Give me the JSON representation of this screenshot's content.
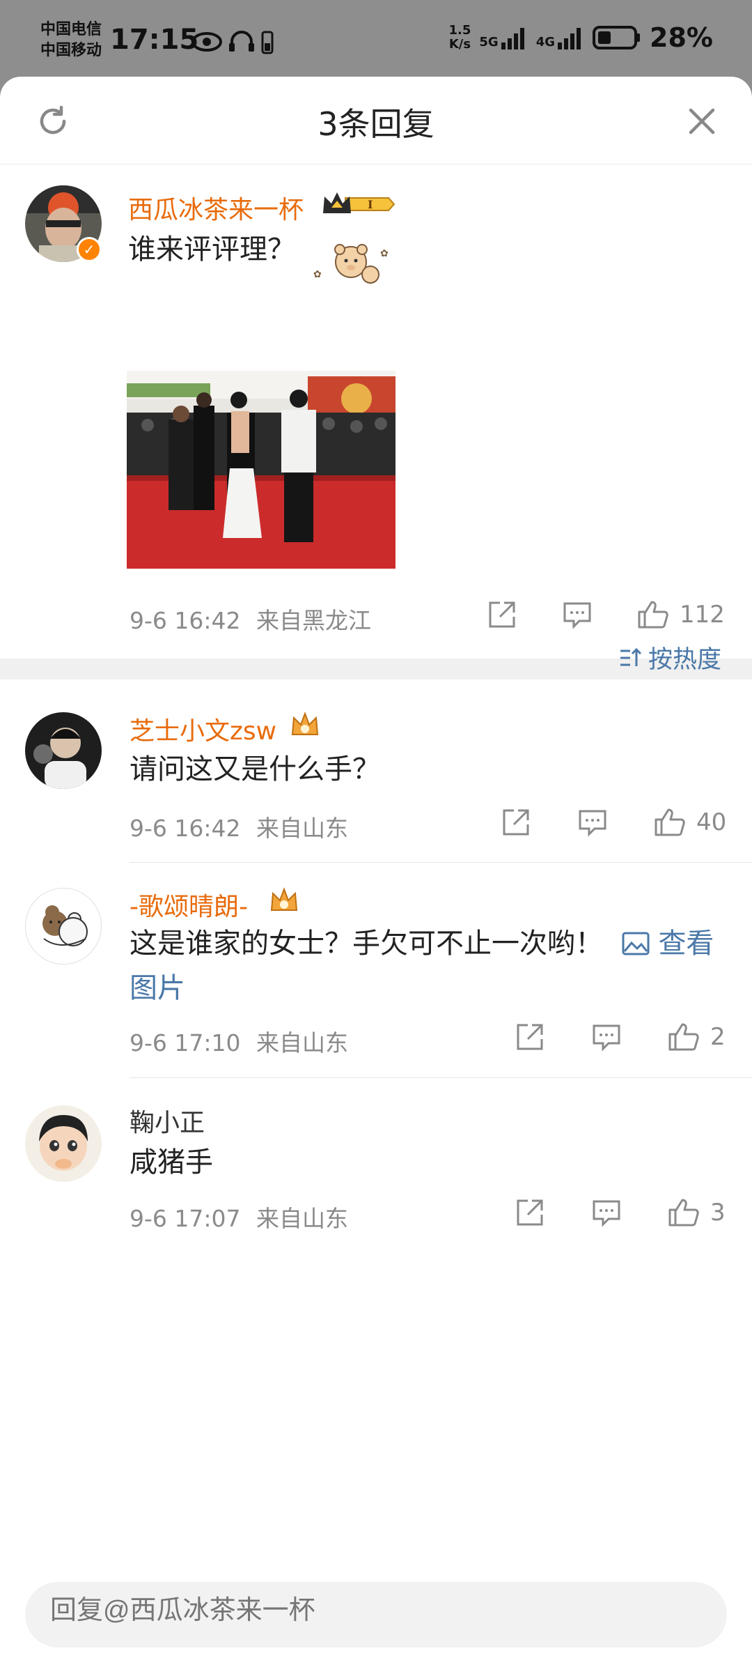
{
  "status_bar": {
    "carrier1": "中国电信",
    "carrier2": "中国移动",
    "time": "17:15",
    "speed_top": "1.5",
    "speed_bottom": "K/s",
    "network1": "5G",
    "network2": "4G",
    "battery": "28%"
  },
  "header": {
    "title": "3条回复"
  },
  "main_comment": {
    "username": "西瓜冰茶来一杯",
    "level_badge": "I",
    "text": "谁来评评理？",
    "timestamp": "9-6 16:42",
    "location": "来自黑龙江",
    "likes": "112"
  },
  "sort": {
    "label": "按热度"
  },
  "replies": [
    {
      "username": "芝士小文zsw",
      "text": "请问这又是什么手？",
      "timestamp": "9-6 16:42",
      "location": "来自山东",
      "likes": "40"
    },
    {
      "username": "-歌颂晴朗-",
      "text": "这是谁家的女士？手欠可不止一次哟！",
      "link": "查看图片",
      "timestamp": "9-6 17:10",
      "location": "来自山东",
      "likes": "2"
    },
    {
      "username": "鞠小正",
      "text": "咸猪手",
      "timestamp": "9-6 17:07",
      "location": "来自山东",
      "likes": "3"
    }
  ],
  "reply_bar": {
    "placeholder": "回复@西瓜冰茶来一杯"
  },
  "colors": {
    "username_orange": "#e86b0c",
    "link_blue": "#4a78a8",
    "meta_gray": "#8a8a8a"
  }
}
